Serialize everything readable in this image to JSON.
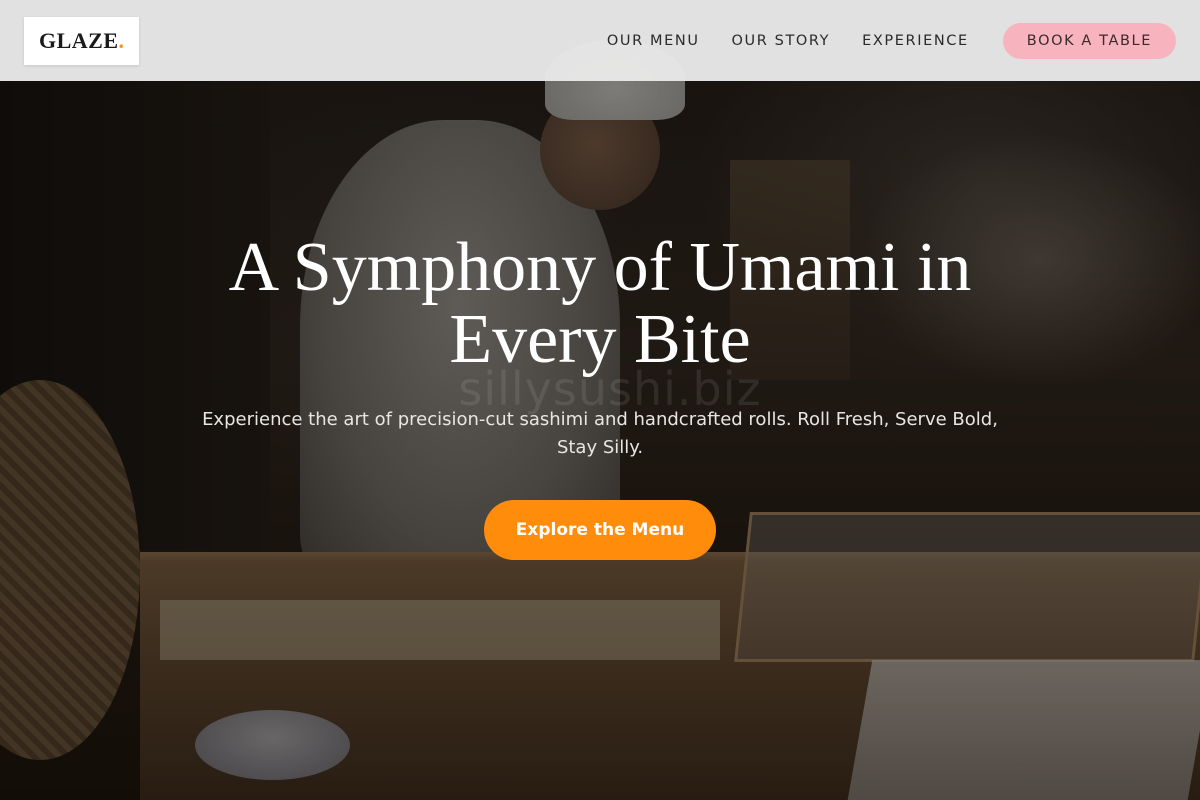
{
  "header": {
    "logo": {
      "text": "GLAZE",
      "dot": "."
    },
    "nav": [
      {
        "label": "OUR MENU"
      },
      {
        "label": "OUR STORY"
      },
      {
        "label": "EXPERIENCE"
      }
    ],
    "book_label": "BOOK A TABLE"
  },
  "hero": {
    "title": "A Symphony of Umami in Every Bite",
    "subtitle": "Experience the art of precision-cut sashimi and handcrafted rolls. Roll Fresh, Serve Bold, Stay Silly.",
    "cta_label": "Explore the Menu",
    "watermark": "sillysushi.biz"
  },
  "colors": {
    "header_bg": "#e8e8e8",
    "book_button": "#f8b4be",
    "cta_button": "#ff8c0a",
    "logo_accent": "#f0961e"
  }
}
